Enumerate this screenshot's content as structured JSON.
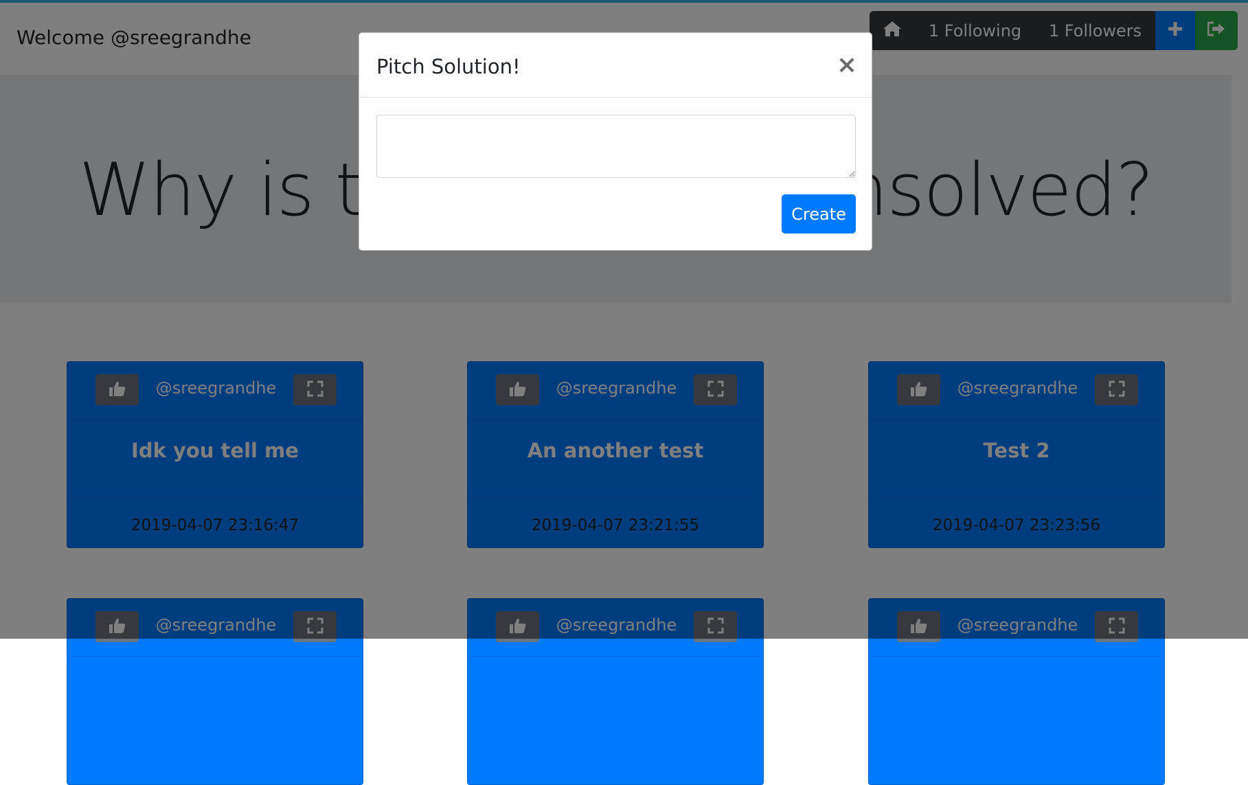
{
  "navbar": {
    "welcome": "Welcome @sreegrandhe",
    "following_label": "1 Following",
    "followers_label": "1 Followers",
    "home_icon": "home-icon",
    "plus_icon": "plus-icon",
    "logout_icon": "sign-out-icon"
  },
  "jumbotron": {
    "title": "Why is this problem unsolved?"
  },
  "cards": [
    {
      "user": "@sreegrandhe",
      "title": "Idk you tell me",
      "date": "2019-04-07 23:16:47"
    },
    {
      "user": "@sreegrandhe",
      "title": "An another test",
      "date": "2019-04-07 23:21:55"
    },
    {
      "user": "@sreegrandhe",
      "title": "Test 2",
      "date": "2019-04-07 23:23:56"
    },
    {
      "user": "@sreegrandhe"
    },
    {
      "user": "@sreegrandhe"
    },
    {
      "user": "@sreegrandhe"
    }
  ],
  "modal": {
    "title": "Pitch Solution!",
    "close_label": "×",
    "textarea_value": "",
    "create_label": "Create"
  },
  "colors": {
    "primary": "#007bff",
    "success": "#28a745",
    "dark": "#343a40",
    "secondary": "#6c757d",
    "backdrop": "rgba(0,0,0,0.5)"
  }
}
